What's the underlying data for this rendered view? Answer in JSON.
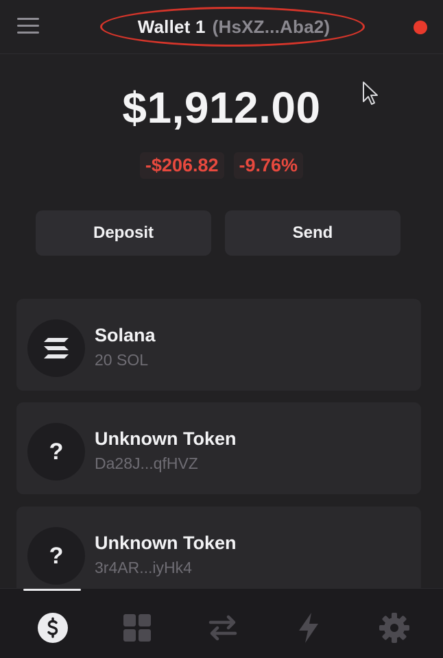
{
  "header": {
    "wallet_name": "Wallet 1",
    "wallet_address": "(HsXZ...Aba2)",
    "menu_icon": "hamburger-menu-icon",
    "status_color": "#e83a2c"
  },
  "balance": {
    "total": "$1,912.00",
    "change_amount": "-$206.82",
    "change_percent": "-9.76%",
    "change_color": "#e8493e"
  },
  "actions": {
    "deposit_label": "Deposit",
    "send_label": "Send"
  },
  "tokens": [
    {
      "name": "Solana",
      "sub": "20 SOL",
      "icon": "solana-logo-icon"
    },
    {
      "name": "Unknown Token",
      "sub": "Da28J...qfHVZ",
      "icon": "question-mark-icon",
      "glyph": "?"
    },
    {
      "name": "Unknown Token",
      "sub": "3r4AR...iyHk4",
      "icon": "question-mark-icon",
      "glyph": "?"
    }
  ],
  "nav": [
    {
      "name": "tokens-dollar-icon",
      "active": true
    },
    {
      "name": "collectibles-grid-icon",
      "active": false
    },
    {
      "name": "swap-arrows-icon",
      "active": false
    },
    {
      "name": "activity-lightning-icon",
      "active": false
    },
    {
      "name": "settings-gear-icon",
      "active": false
    }
  ],
  "colors": {
    "background": "#222123",
    "card": "#2a292c",
    "highlight_ring": "#d6352a"
  }
}
